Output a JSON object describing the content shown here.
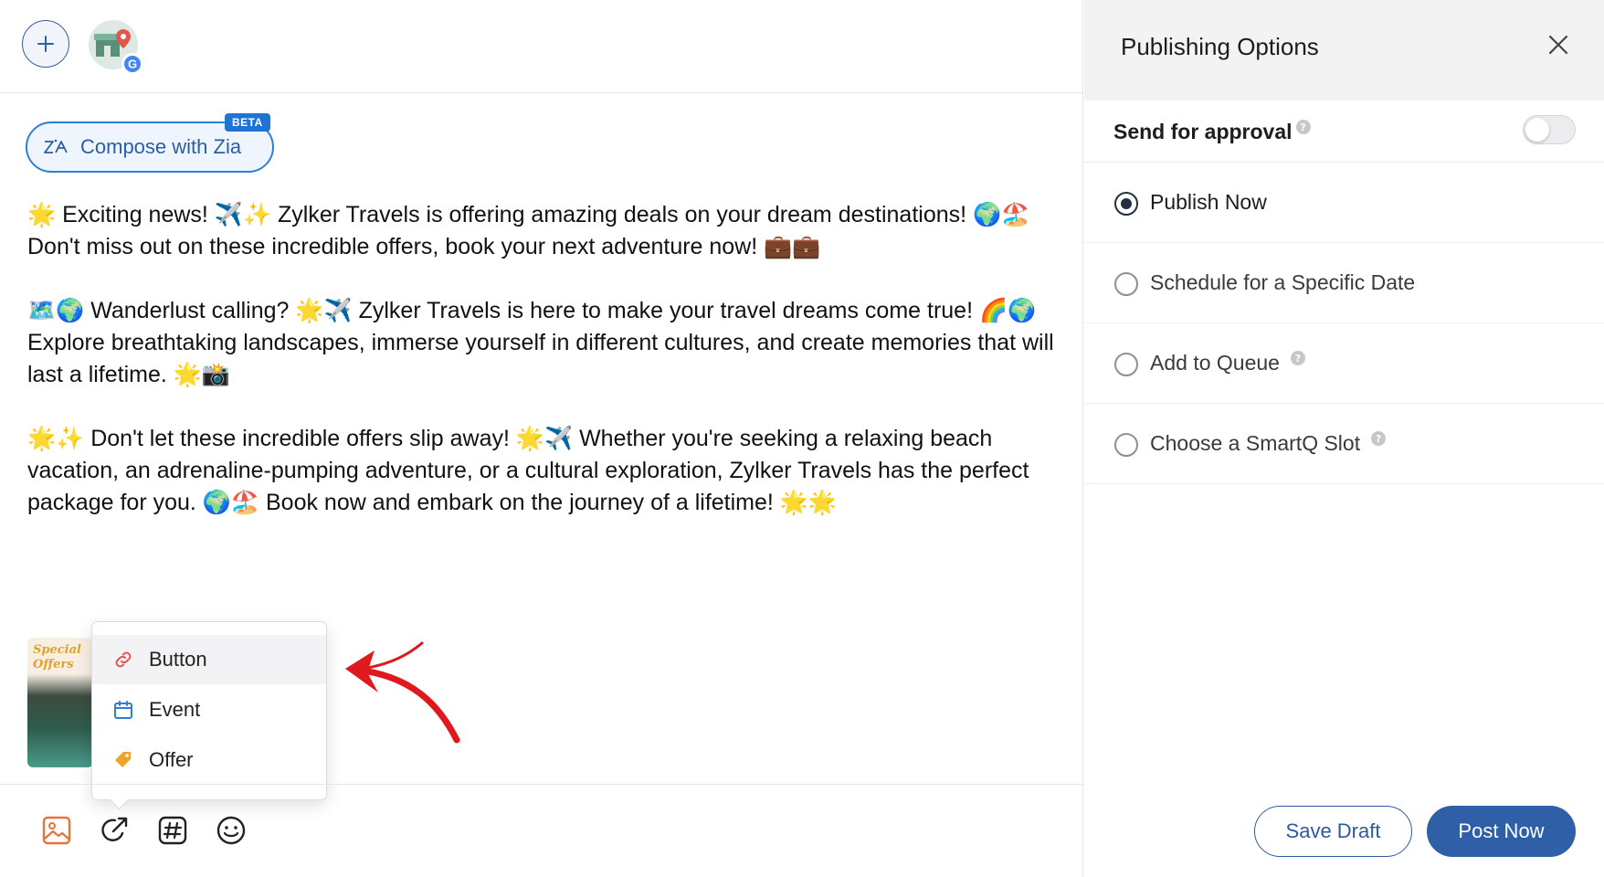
{
  "composer": {
    "zia_label": "Compose with Zia",
    "zia_badge": "BETA",
    "post_paragraphs": [
      "🌟 Exciting news! ✈️✨ Zylker Travels is offering amazing deals on your dream destinations! 🌍🏖️ Don't miss out on these incredible offers, book your next adventure now! 💼💼",
      "🗺️🌍 Wanderlust calling? 🌟✈️ Zylker Travels is here to make your travel dreams come true! 🌈🌍 Explore breathtaking landscapes, immerse yourself in different cultures, and create memories that will last a lifetime. 🌟📸",
      "🌟✨ Don't let these incredible offers slip away! 🌟✈️ Whether you're seeking a relaxing beach vacation, an adrenaline-pumping adventure, or a cultural exploration, Zylker Travels has the perfect package for you. 🌍🏖️ Book now and embark on the journey of a lifetime! 🌟🌟"
    ],
    "thumbnail_text": "Special Offers"
  },
  "action_menu": {
    "items": [
      {
        "label": "Button",
        "icon": "link-icon",
        "color": "#e55353"
      },
      {
        "label": "Event",
        "icon": "calendar-icon",
        "color": "#2f7fd6"
      },
      {
        "label": "Offer",
        "icon": "tag-icon",
        "color": "#f0a22a"
      }
    ]
  },
  "toolbar": {
    "icons": [
      "image-icon",
      "action-arrow-icon",
      "hashtag-icon",
      "emoji-icon"
    ]
  },
  "panel": {
    "title": "Publishing Options",
    "approval_label": "Send for approval",
    "approval_enabled": false,
    "options": [
      {
        "label": "Publish Now",
        "selected": true,
        "help": false
      },
      {
        "label": "Schedule for a Specific Date",
        "selected": false,
        "help": false
      },
      {
        "label": "Add to Queue",
        "selected": false,
        "help": true
      },
      {
        "label": "Choose a SmartQ Slot",
        "selected": false,
        "help": true
      }
    ],
    "help_glyph": "?"
  },
  "footer": {
    "save_label": "Save Draft",
    "post_label": "Post Now"
  },
  "colors": {
    "primary": "#2f5fa7",
    "accent": "#2f7fd6",
    "annotation_arrow": "#e0191f"
  }
}
